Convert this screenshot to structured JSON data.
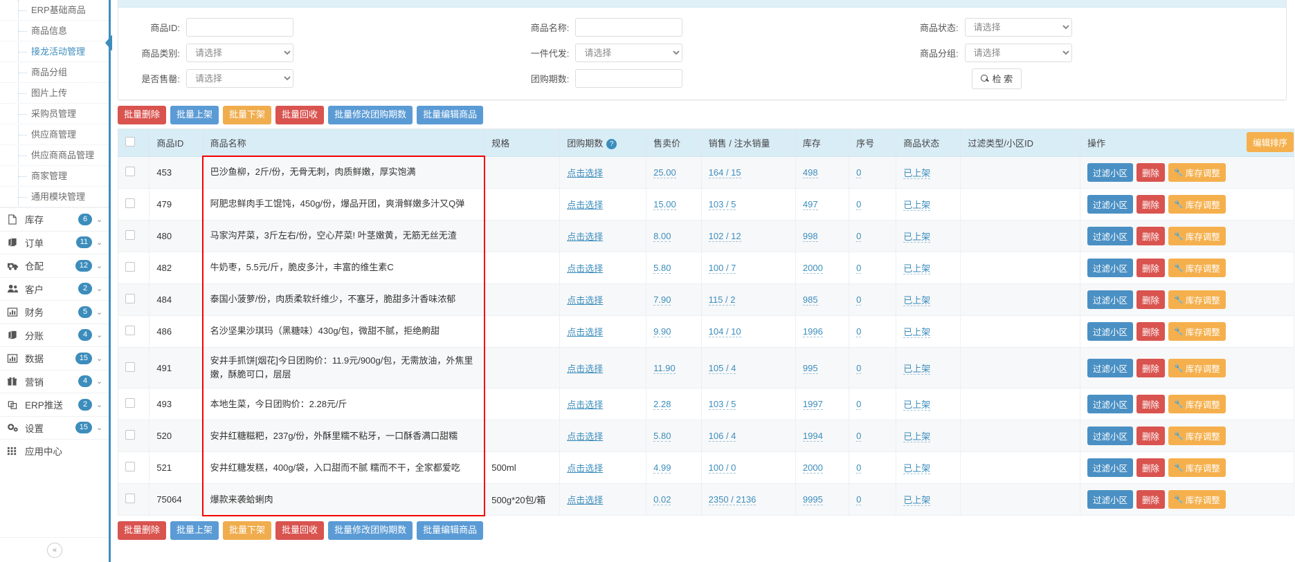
{
  "sidebar": {
    "sub_items": [
      {
        "label": "ERP基础商品",
        "active": false
      },
      {
        "label": "商品信息",
        "active": false
      },
      {
        "label": "接龙活动管理",
        "active": true
      },
      {
        "label": "商品分组",
        "active": false
      },
      {
        "label": "图片上传",
        "active": false
      },
      {
        "label": "采购员管理",
        "active": false
      },
      {
        "label": "供应商管理",
        "active": false
      },
      {
        "label": "供应商商品管理",
        "active": false
      },
      {
        "label": "商家管理",
        "active": false
      },
      {
        "label": "通用模块管理",
        "active": false
      }
    ],
    "main_items": [
      {
        "label": "库存",
        "badge": "6",
        "icon": "document-icon"
      },
      {
        "label": "订单",
        "badge": "11",
        "icon": "book-icon"
      },
      {
        "label": "仓配",
        "badge": "12",
        "icon": "truck-icon"
      },
      {
        "label": "客户",
        "badge": "2",
        "icon": "users-icon"
      },
      {
        "label": "财务",
        "badge": "5",
        "icon": "bar-chart-icon"
      },
      {
        "label": "分账",
        "badge": "4",
        "icon": "book-icon"
      },
      {
        "label": "数据",
        "badge": "15",
        "icon": "bar-chart-icon"
      },
      {
        "label": "营销",
        "badge": "4",
        "icon": "gift-icon"
      },
      {
        "label": "ERP推送",
        "badge": "2",
        "icon": "copy-icon"
      },
      {
        "label": "设置",
        "badge": "15",
        "icon": "gears-icon"
      },
      {
        "label": "应用中心",
        "badge": "",
        "icon": "grid-icon"
      }
    ],
    "collapse_label": "«"
  },
  "search": {
    "fields": [
      {
        "label": "商品ID:",
        "type": "input",
        "value": "",
        "placeholder": ""
      },
      {
        "label": "商品名称:",
        "type": "input",
        "value": "",
        "placeholder": ""
      },
      {
        "label": "商品状态:",
        "type": "select",
        "value": "请选择"
      },
      {
        "label": "商品类别:",
        "type": "select",
        "value": "请选择"
      },
      {
        "label": "一件代发:",
        "type": "select",
        "value": "请选择"
      },
      {
        "label": "商品分组:",
        "type": "select",
        "value": "请选择"
      },
      {
        "label": "是否售罄:",
        "type": "select",
        "value": "请选择"
      },
      {
        "label": "团购期数:",
        "type": "input",
        "value": "",
        "placeholder": ""
      }
    ],
    "search_button": "检 索"
  },
  "toolbar": {
    "buttons": [
      {
        "label": "批量删除",
        "color": "red"
      },
      {
        "label": "批量上架",
        "color": "blue"
      },
      {
        "label": "批量下架",
        "color": "orange"
      },
      {
        "label": "批量回收",
        "color": "red"
      },
      {
        "label": "批量修改团购期数",
        "color": "blue"
      },
      {
        "label": "批量编辑商品",
        "color": "blue"
      }
    ]
  },
  "table": {
    "headers": [
      "",
      "商品ID",
      "商品名称",
      "规格",
      "团购期数",
      "售卖价",
      "销售 / 注水销量",
      "库存",
      "序号",
      "商品状态",
      "过滤类型/小区ID",
      "操作"
    ],
    "sort_button": "编辑排序",
    "period_help": "?",
    "pick_text": "点击选择",
    "op_labels": {
      "filter": "过滤小区",
      "delete": "删除",
      "stock": "库存调整"
    },
    "rows": [
      {
        "id": "453",
        "name": "巴沙鱼柳，2斤/份，无骨无刺，肉质鲜嫩，厚实饱满",
        "spec": "",
        "period": "点击选择",
        "price": "25.00",
        "sales": "164 / 15",
        "stock": "498",
        "seq": "0",
        "status": "已上架",
        "filter": ""
      },
      {
        "id": "479",
        "name": "阿肥忠鲜肉手工馄饨，450g/份，爆品开团，爽滑鲜嫩多汁又Q弹",
        "spec": "",
        "period": "点击选择",
        "price": "15.00",
        "sales": "103 / 5",
        "stock": "497",
        "seq": "0",
        "status": "已上架",
        "filter": ""
      },
      {
        "id": "480",
        "name": "马家沟芹菜，3斤左右/份，空心芹菜! 叶茎嫩黄，无筋无丝无渣",
        "spec": "",
        "period": "点击选择",
        "price": "8.00",
        "sales": "102 / 12",
        "stock": "998",
        "seq": "0",
        "status": "已上架",
        "filter": ""
      },
      {
        "id": "482",
        "name": "牛奶枣，5.5元/斤，脆皮多汁，丰富的维生素C",
        "spec": "",
        "period": "点击选择",
        "price": "5.80",
        "sales": "100 / 7",
        "stock": "2000",
        "seq": "0",
        "status": "已上架",
        "filter": ""
      },
      {
        "id": "484",
        "name": "泰国小菠萝/份，肉质柔软纤维少，不塞牙，脆甜多汁香味浓郁",
        "spec": "",
        "period": "点击选择",
        "price": "7.90",
        "sales": "115 / 2",
        "stock": "985",
        "seq": "0",
        "status": "已上架",
        "filter": ""
      },
      {
        "id": "486",
        "name": "名沙坚果沙琪玛（黑糖味）430g/包，微甜不腻，拒绝齁甜",
        "spec": "",
        "period": "点击选择",
        "price": "9.90",
        "sales": "104 / 10",
        "stock": "1996",
        "seq": "0",
        "status": "已上架",
        "filter": ""
      },
      {
        "id": "491",
        "name": "安井手抓饼[烟花]今日团购价：11.9元/900g/包，无需放油，外焦里嫩，酥脆可口，层层",
        "spec": "",
        "period": "点击选择",
        "price": "11.90",
        "sales": "105 / 4",
        "stock": "995",
        "seq": "0",
        "status": "已上架",
        "filter": ""
      },
      {
        "id": "493",
        "name": "本地生菜，今日团购价：2.28元/斤",
        "spec": "",
        "period": "点击选择",
        "price": "2.28",
        "sales": "103 / 5",
        "stock": "1997",
        "seq": "0",
        "status": "已上架",
        "filter": ""
      },
      {
        "id": "520",
        "name": "安井红糖糍粑，237g/份，外酥里糯不粘牙，一口酥香满口甜糯",
        "spec": "",
        "period": "点击选择",
        "price": "5.80",
        "sales": "106 / 4",
        "stock": "1994",
        "seq": "0",
        "status": "已上架",
        "filter": ""
      },
      {
        "id": "521",
        "name": "安井红糖发糕，400g/袋，入口甜而不腻 糯而不干，全家都爱吃",
        "spec": "500ml",
        "period": "点击选择",
        "price": "4.99",
        "sales": "100 / 0",
        "stock": "2000",
        "seq": "0",
        "status": "已上架",
        "filter": ""
      },
      {
        "id": "75064",
        "name": "爆款来袭蛤蜊肉",
        "spec": "500g*20包/箱",
        "period": "点击选择",
        "price": "0.02",
        "sales": "2350 / 2136",
        "stock": "9995",
        "seq": "0",
        "status": "已上架",
        "filter": ""
      }
    ]
  },
  "bottom_toolbar": {
    "buttons": [
      {
        "label": "批量删除",
        "color": "red"
      },
      {
        "label": "批量上架",
        "color": "blue"
      },
      {
        "label": "批量下架",
        "color": "orange"
      },
      {
        "label": "批量回收",
        "color": "red"
      },
      {
        "label": "批量修改团购期数",
        "color": "blue"
      },
      {
        "label": "批量编辑商品",
        "color": "blue"
      }
    ]
  },
  "colors": {
    "accent": "#3c8dbc",
    "header_bg": "#d9edf7",
    "red": "#d9534f",
    "blue": "#5b9bd5",
    "orange": "#f0ad4e",
    "highlight_box": "#f40000"
  }
}
